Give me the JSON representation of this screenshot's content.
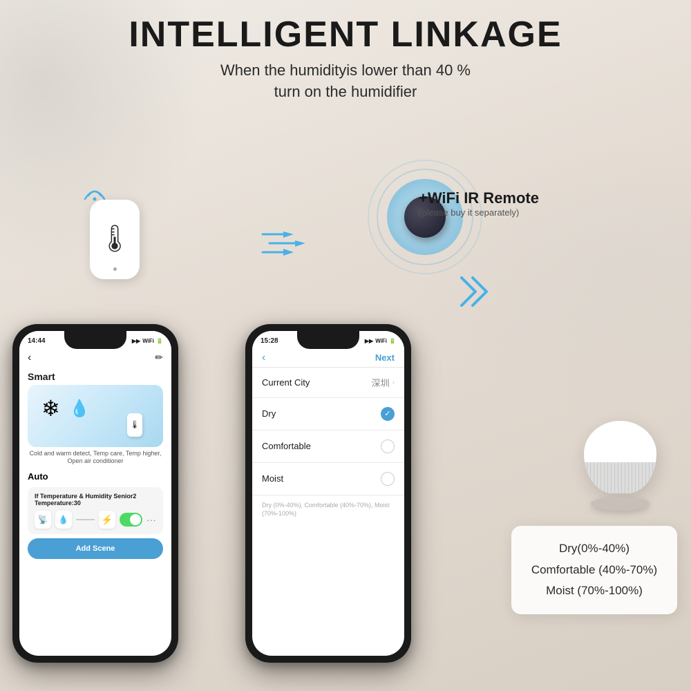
{
  "header": {
    "main_title": "INTELLIGENT LINKAGE",
    "subtitle_line1": "When the humidityis lower than 40 %",
    "subtitle_line2": "turn on the humidifier"
  },
  "ir_remote": {
    "label": "+WiFi IR Remote",
    "sublabel": "(please buy it separately)"
  },
  "left_phone": {
    "status_time": "14:44",
    "status_signal": "◀",
    "section_smart": "Smart",
    "automation_desc": "Cold and warm detect, Temp care, Temp higher, Open air conditioner",
    "section_auto": "Auto",
    "card_title": "If Temperature & Humidity Senior2 Temperature:30",
    "add_scene": "Add Scene"
  },
  "right_phone": {
    "status_time": "15:28",
    "nav_back": "‹",
    "nav_next": "Next",
    "row_city_label": "Current City",
    "row_city_value": "深圳",
    "option_dry": "Dry",
    "option_comfortable": "Comfortable",
    "option_moist": "Moist",
    "hint": "Dry (0%-40%), Comfortable (40%-70%), Moist (70%-100%)"
  },
  "info_box": {
    "item1": "Dry(0%-40%)",
    "item2": "Comfortable (40%-70%)",
    "item3": "Moist (70%-100%)"
  }
}
